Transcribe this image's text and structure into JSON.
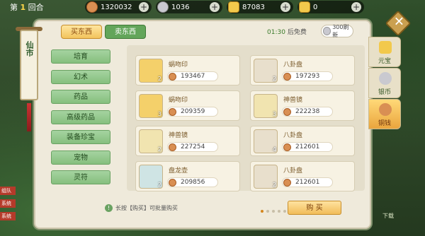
{
  "round": {
    "prefix": "第",
    "number": "1",
    "suffix": "回合"
  },
  "currencies": [
    {
      "name": "copper-coin",
      "value": "1320032",
      "color": "#d98f53"
    },
    {
      "name": "silver-coin",
      "value": "1036",
      "color": "#c9c9d0"
    },
    {
      "name": "gold-ingot",
      "value": "87083",
      "color": "#f2c94c"
    },
    {
      "name": "yuanbao-ingot",
      "value": "0",
      "color": "#f2c94c"
    }
  ],
  "tabs": {
    "buy": "买东西",
    "sell": "卖东西"
  },
  "timer": {
    "time": "01:30",
    "label": "后免费"
  },
  "refresh": {
    "label": "300刷新"
  },
  "scroll_title": "仙市",
  "menu": [
    "培育",
    "幻术",
    "药品",
    "高级药品",
    "装备珍宝",
    "宠物",
    "灵符"
  ],
  "items": [
    {
      "name": "蜗吻印",
      "price": "193467",
      "qty": "2",
      "icon": "seal-icon"
    },
    {
      "name": "八卦盘",
      "price": "197293",
      "qty": "2",
      "icon": "bagua-icon"
    },
    {
      "name": "蜗吻印",
      "price": "209359",
      "qty": "3",
      "icon": "seal-icon"
    },
    {
      "name": "神兽镜",
      "price": "222238",
      "qty": "3",
      "icon": "mirror-icon"
    },
    {
      "name": "神兽镜",
      "price": "227254",
      "qty": "2",
      "icon": "mirror-icon"
    },
    {
      "name": "八卦盘",
      "price": "212601",
      "qty": "4",
      "icon": "bagua-icon"
    },
    {
      "name": "盘龙壶",
      "price": "209856",
      "qty": "2",
      "icon": "pot-icon"
    },
    {
      "name": "八卦盘",
      "price": "212601",
      "qty": "2",
      "icon": "bagua-icon"
    }
  ],
  "pager": {
    "pages": 6,
    "current": 0
  },
  "hint": "长按【购买】可批量购买",
  "buy_button": "购 买",
  "right_tabs": [
    {
      "label": "元宝",
      "active": false
    },
    {
      "label": "银币",
      "active": false
    },
    {
      "label": "铜钱",
      "active": true
    }
  ],
  "side_labels": [
    "组队",
    "系统",
    "系统"
  ],
  "watermark": "下载"
}
